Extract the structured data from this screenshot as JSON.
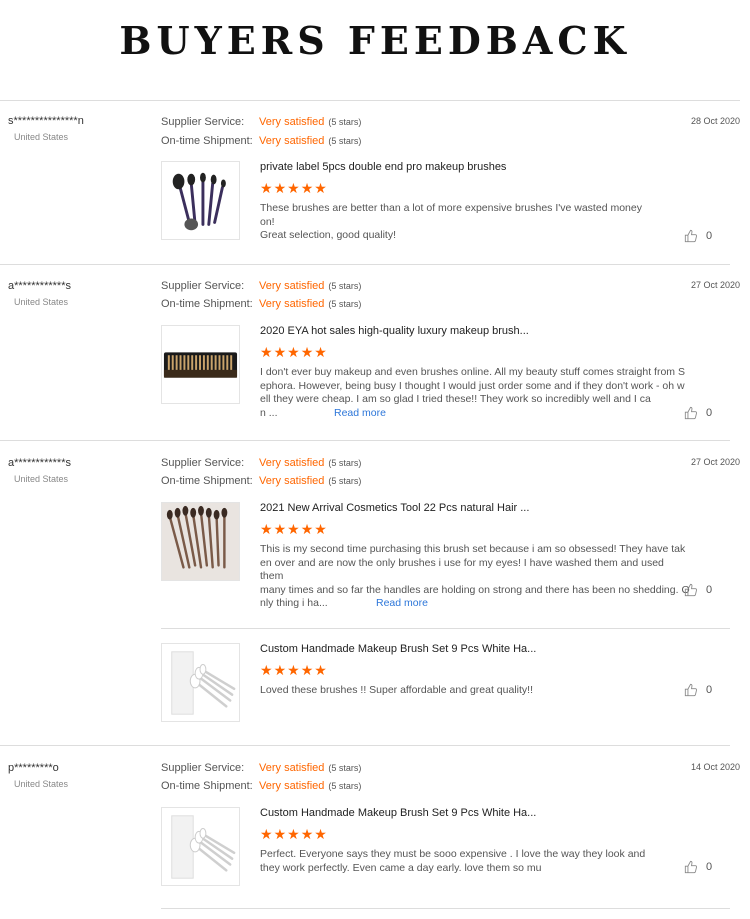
{
  "page": {
    "title": "BUYERS FEEDBACK"
  },
  "labels": {
    "supplier_service": "Supplier Service:",
    "shipment": "On-time Shipment:",
    "read_more": "Read more"
  },
  "icons": {
    "star": "star-icon",
    "like": "thumbs-up-icon"
  },
  "colors": {
    "accent": "#ff6600",
    "link": "#2c76d9"
  },
  "reviews": [
    {
      "buyer": "s***************n",
      "country": "United States",
      "supplier_rating": "Very satisfied",
      "supplier_stars": "(5 stars)",
      "shipment_rating": "Very satisfied",
      "shipment_stars": "(5 stars)",
      "date": "28 Oct 2020",
      "items": [
        {
          "product": "private label 5pcs double end pro makeup brushes",
          "rating": 5,
          "text_lines": [
            "These brushes are better than a lot of more expensive brushes I've wasted money",
            "on!",
            "Great selection, good quality!"
          ],
          "likes": "0"
        }
      ]
    },
    {
      "buyer": "a************s",
      "country": "United States",
      "supplier_rating": "Very satisfied",
      "supplier_stars": "(5 stars)",
      "shipment_rating": "Very satisfied",
      "shipment_stars": "(5 stars)",
      "date": "27 Oct 2020",
      "items": [
        {
          "product": "2020 EYA hot sales high-quality luxury makeup brush...",
          "rating": 5,
          "text_lines": [
            "I don't ever buy makeup and even brushes online. All my beauty stuff comes straight from S",
            "ephora. However, being busy I thought I would just order some and if they don't work - oh w",
            "ell they were cheap. I am so glad I tried these!! They work so incredibly well and I ca",
            "n ..."
          ],
          "likes": "0"
        }
      ]
    },
    {
      "buyer": "a************s",
      "country": "United States",
      "supplier_rating": "Very satisfied",
      "supplier_stars": "(5 stars)",
      "shipment_rating": "Very satisfied",
      "shipment_stars": "(5 stars)",
      "date": "27 Oct 2020",
      "items": [
        {
          "product": "2021 New Arrival Cosmetics Tool 22 Pcs natural Hair ...",
          "rating": 5,
          "text_lines": [
            "This is my second time purchasing this brush set because i am so obsessed! They have tak",
            "en over and are now the only brushes i use for my eyes! I have washed them and used them",
            "many times and so far the handles are holding on strong and there has been no shedding. O",
            "nly thing i ha..."
          ],
          "likes": "0"
        },
        {
          "product": "Custom Handmade Makeup Brush Set 9 Pcs White Ha...",
          "rating": 5,
          "text_lines": [
            "Loved these brushes !! Super affordable and great quality!!"
          ],
          "likes": "0"
        }
      ]
    },
    {
      "buyer": "p*********o",
      "country": "United States",
      "supplier_rating": "Very satisfied",
      "supplier_stars": "(5 stars)",
      "shipment_rating": "Very satisfied",
      "shipment_stars": "(5 stars)",
      "date": "14 Oct 2020",
      "items": [
        {
          "product": "Custom Handmade Makeup Brush Set 9 Pcs White Ha...",
          "rating": 5,
          "text_lines": [
            "Perfect. Everyone says they must be sooo expensive . I love the way they look and",
            "they work perfectly. Even came a day early. love them so mu"
          ],
          "likes": "0"
        }
      ]
    }
  ]
}
